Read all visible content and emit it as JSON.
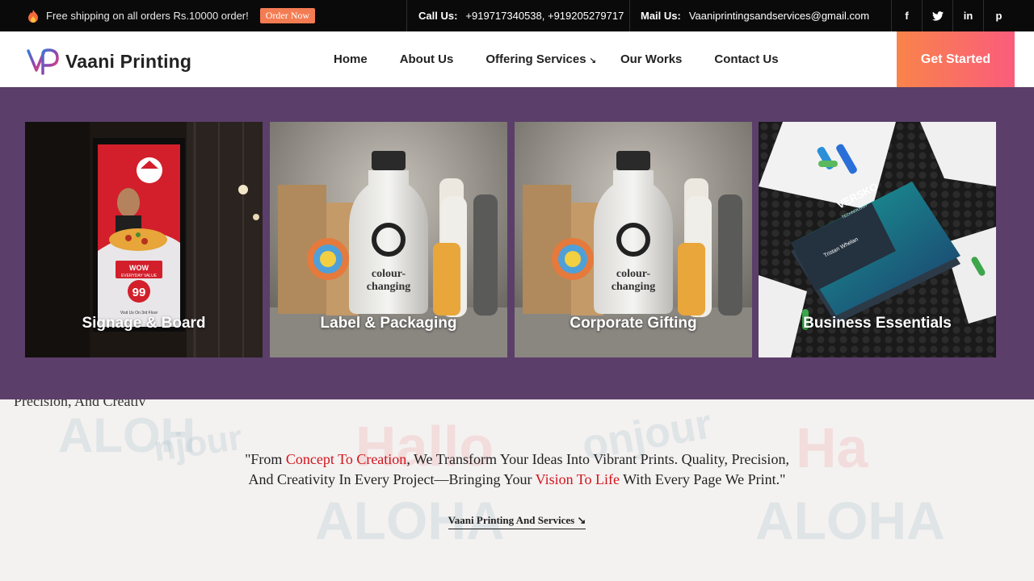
{
  "topbar": {
    "promo_text": "Free shipping on all orders Rs.10000 order!",
    "order_btn": "Order Now",
    "call_label": "Call Us:",
    "call_value": "+919717340538, +919205279717",
    "mail_label": "Mail Us:",
    "mail_value": "Vaaniprintingsandservices@gmail.com",
    "socials": [
      "f",
      "t",
      "in",
      "p"
    ]
  },
  "header": {
    "logo_text": "Vaani Printing",
    "nav": {
      "home": "Home",
      "about": "About Us",
      "services": "Offering Services",
      "services_arrow": "↘",
      "works": "Our Works",
      "contact": "Contact Us"
    },
    "cta": "Get Started"
  },
  "mega_menu": {
    "bg_color": "#5b3e6a",
    "cards": [
      {
        "caption": "Signage & Board",
        "sign": {
          "brand": "Pizza Hut",
          "wow": "WOW",
          "value": "EVERYDAY VALUE",
          "number": "99",
          "visit": "Visit Us On 3rd Floor"
        }
      },
      {
        "caption": "Label & Packaging",
        "bottle_text_1": "colour-",
        "bottle_text_2": "changing"
      },
      {
        "caption": "Corporate Gifting",
        "bottle_text_1": "colour-",
        "bottle_text_2": "changing"
      },
      {
        "caption": "Business Essentials",
        "card_brand": "VERSKO",
        "card_sub": "TECHNOLOGY",
        "card_name": "Tristan Whelan"
      }
    ]
  },
  "quote_section": {
    "peek_left": "Precision, And Creativ",
    "watermarks": [
      "ALOH",
      "njour",
      "Hallo",
      "onjour",
      "Ha",
      "ALOHA",
      "ALOHA"
    ],
    "quote_pre": "\"From ",
    "quote_hl1": "Concept To Creation",
    "quote_mid": ", We Transform Your Ideas Into Vibrant Prints. Quality, Precision, And Creativity In Every Project—Bringing Your ",
    "quote_hl2": "Vision To Life",
    "quote_post": " With Every Page We Print.\"",
    "signature": "Vaani Printing And Services ↘"
  }
}
